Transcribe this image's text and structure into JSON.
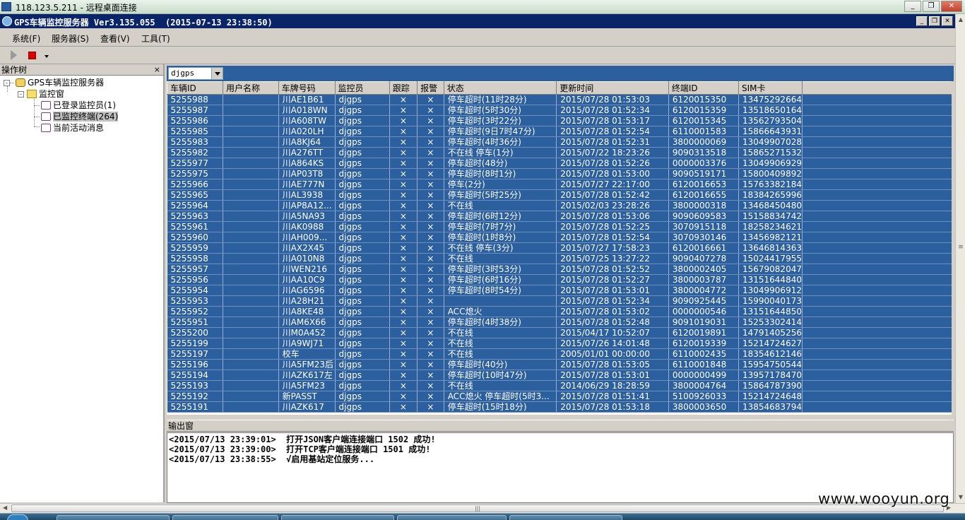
{
  "remote_window": {
    "title": "118.123.5.211 - 远程桌面连接",
    "buttons": [
      "minimize",
      "restore",
      "close"
    ]
  },
  "app": {
    "title": "GPS车辆监控服务器 Ver3.135.055  (2015-07-13 23:38:50)"
  },
  "menu": [
    "系统(F)",
    "服务器(S)",
    "查看(V)",
    "工具(T)"
  ],
  "toolbar": {
    "play_icon": "play-icon",
    "stop_icon": "stop-icon"
  },
  "tree_panel": {
    "title": "操作树",
    "close": "×",
    "root": "GPS车辆监控服务器",
    "folder": "监控窗",
    "items": [
      "已登录监控员(1)",
      "已监控终端(264)",
      "当前活动消息"
    ],
    "selected_index": 1
  },
  "filter": {
    "value": "djgps"
  },
  "grid": {
    "columns": [
      "车辆ID",
      "用户名称",
      "车牌号码",
      "监控员",
      "跟踪",
      "报警",
      "状态",
      "更新时间",
      "终端ID",
      "SIM卡"
    ],
    "rows": [
      [
        "5255988",
        "",
        "川AE1B61",
        "djgps",
        "×",
        "×",
        "停车超时(11时28分)",
        "2015/07/28 01:53:03",
        "6120015350",
        "13475292664"
      ],
      [
        "5255987",
        "",
        "川A018WN",
        "djgps",
        "×",
        "×",
        "停车超时(5时30分)",
        "2015/07/28 01:52:34",
        "6120015359",
        "13518650164"
      ],
      [
        "5255986",
        "",
        "川A608TW",
        "djgps",
        "×",
        "×",
        "停车超时(3时22分)",
        "2015/07/28 01:53:17",
        "6120015345",
        "13562793504"
      ],
      [
        "5255985",
        "",
        "川A020LH",
        "djgps",
        "×",
        "×",
        "停车超时(9日7时47分)",
        "2015/07/28 01:52:54",
        "6110001583",
        "15866643931"
      ],
      [
        "5255983",
        "",
        "川A8KJ64",
        "djgps",
        "×",
        "×",
        "停车超时(4时36分)",
        "2015/07/28 01:52:31",
        "3800000069",
        "13049907028"
      ],
      [
        "5255982",
        "",
        "川A276TT",
        "djgps",
        "×",
        "×",
        "不在线 停车(1分)",
        "2015/07/22 18:23:26",
        "9090313518",
        "15865271532"
      ],
      [
        "5255977",
        "",
        "川A864KS",
        "djgps",
        "×",
        "×",
        "停车超时(48分)",
        "2015/07/28 01:52:26",
        "0000003376",
        "13049906929"
      ],
      [
        "5255975",
        "",
        "川AP03T8",
        "djgps",
        "×",
        "×",
        "停车超时(8时1分)",
        "2015/07/28 01:53:00",
        "9090519171",
        "15800409892"
      ],
      [
        "5255966",
        "",
        "川AE777N",
        "djgps",
        "×",
        "×",
        "停车(2分)",
        "2015/07/27 22:17:00",
        "6120016653",
        "15763382184"
      ],
      [
        "5255965",
        "",
        "川AL3938",
        "djgps",
        "×",
        "×",
        "停车超时(5时25分)",
        "2015/07/28 01:52:42",
        "6120016655",
        "18384265996"
      ],
      [
        "5255964",
        "",
        "川AP8A12...",
        "djgps",
        "×",
        "×",
        "不在线",
        "2015/02/03 23:28:26",
        "3800000318",
        "13468450480"
      ],
      [
        "5255963",
        "",
        "川A5NA93",
        "djgps",
        "×",
        "×",
        "停车超时(6时12分)",
        "2015/07/28 01:53:06",
        "9090609583",
        "15158834742"
      ],
      [
        "5255961",
        "",
        "川AK0988",
        "djgps",
        "×",
        "×",
        "停车超时(7时7分)",
        "2015/07/28 01:52:25",
        "3070915118",
        "18258234621"
      ],
      [
        "5255960",
        "",
        "川AH009...",
        "djgps",
        "×",
        "×",
        "停车超时(1时8分)",
        "2015/07/28 01:52:54",
        "3070930146",
        "13456982121"
      ],
      [
        "5255959",
        "",
        "川AX2X45",
        "djgps",
        "×",
        "×",
        "不在线 停车(3分)",
        "2015/07/27 17:58:23",
        "6120016661",
        "13646814363"
      ],
      [
        "5255958",
        "",
        "川A010N8",
        "djgps",
        "×",
        "×",
        "不在线",
        "2015/07/25 13:27:22",
        "9090407278",
        "15024417955"
      ],
      [
        "5255957",
        "",
        "川WEN216",
        "djgps",
        "×",
        "×",
        "停车超时(3时53分)",
        "2015/07/28 01:52:52",
        "3800002405",
        "15679082047"
      ],
      [
        "5255956",
        "",
        "川AA10C9",
        "djgps",
        "×",
        "×",
        "停车超时(6时16分)",
        "2015/07/28 01:52:27",
        "3800003787",
        "13151644840"
      ],
      [
        "5255954",
        "",
        "川AG6596",
        "djgps",
        "×",
        "×",
        "停车超时(8时54分)",
        "2015/07/28 01:53:01",
        "3800004772",
        "13049906912"
      ],
      [
        "5255953",
        "",
        "川A28H21",
        "djgps",
        "×",
        "×",
        "",
        "2015/07/28 01:52:34",
        "9090925445",
        "15990040173"
      ],
      [
        "5255952",
        "",
        "川A8KE48",
        "djgps",
        "×",
        "×",
        "ACC熄火",
        "2015/07/28 01:53:02",
        "0000000546",
        "13151644850"
      ],
      [
        "5255951",
        "",
        "川AM6X66",
        "djgps",
        "×",
        "×",
        "停车超时(4时38分)",
        "2015/07/28 01:52:48",
        "9091019031",
        "15253302414"
      ],
      [
        "5255200",
        "",
        "川M0A452",
        "djgps",
        "×",
        "×",
        "不在线",
        "2015/04/17 10:52:07",
        "6120019891",
        "14791405256"
      ],
      [
        "5255199",
        "",
        "川A9WJ71",
        "djgps",
        "×",
        "×",
        "不在线",
        "2015/07/26 14:01:48",
        "6120019339",
        "15214724627"
      ],
      [
        "5255197",
        "",
        "校车",
        "djgps",
        "×",
        "×",
        "不在线",
        "2005/01/01 00:00:00",
        "6110002435",
        "18354612146"
      ],
      [
        "5255196",
        "",
        "川A5FM23后",
        "djgps",
        "×",
        "×",
        "停车超时(40分)",
        "2015/07/28 01:53:05",
        "6110001848",
        "15954750544"
      ],
      [
        "5255194",
        "",
        "川AZK617左",
        "djgps",
        "×",
        "×",
        "停车超时(10时47分)",
        "2015/07/28 01:53:01",
        "0000000499",
        "13957178470"
      ],
      [
        "5255193",
        "",
        "川A5FM23",
        "djgps",
        "×",
        "×",
        "不在线",
        "2014/06/29 18:28:59",
        "3800004764",
        "15864787390"
      ],
      [
        "5255192",
        "",
        "新PASST",
        "djgps",
        "×",
        "×",
        "ACC熄火 停车超时(5时3...",
        "2015/07/28 01:51:41",
        "5100926033",
        "15214724648"
      ],
      [
        "5255191",
        "",
        "川AZK617",
        "djgps",
        "×",
        "×",
        "停车超时(15时18分)",
        "2015/07/28 01:53:18",
        "3800003650",
        "13854683794"
      ]
    ]
  },
  "output": {
    "title": "输出窗",
    "lines": [
      "<2015/07/13 23:39:01>  打开JSON客户端连接端口 1502 成功!",
      "<2015/07/13 23:39:00>  打开TCP客户端连接端口 1501 成功!",
      "<2015/07/13 23:38:55>  √启用基站定位服务..."
    ]
  },
  "watermark": "www.wooyun.org",
  "colors": {
    "grid_selection": "#2c5f9e",
    "title_bar": "#0a246a",
    "stop_button": "#e00000"
  }
}
